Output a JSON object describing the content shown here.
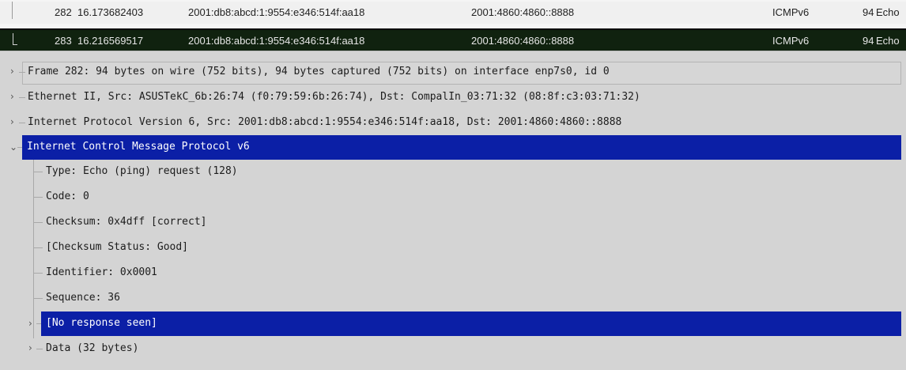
{
  "packets": [
    {
      "no": "282",
      "time": "16.173682403",
      "source": "2001:db8:abcd:1:9554:e346:514f:aa18",
      "destination": "2001:4860:4860::8888",
      "protocol": "ICMPv6",
      "length": "94",
      "info": "Echo"
    },
    {
      "no": "283",
      "time": "16.216569517",
      "source": "2001:db8:abcd:1:9554:e346:514f:aa18",
      "destination": "2001:4860:4860::8888",
      "protocol": "ICMPv6",
      "length": "94",
      "info": "Echo"
    }
  ],
  "tree": {
    "frame": "Frame 282: 94 bytes on wire (752 bits), 94 bytes captured (752 bits) on interface enp7s0, id 0",
    "ethernet": "Ethernet II, Src: ASUSTekC_6b:26:74 (f0:79:59:6b:26:74), Dst: CompalIn_03:71:32 (08:8f:c3:03:71:32)",
    "ipv6": "Internet Protocol Version 6, Src: 2001:db8:abcd:1:9554:e346:514f:aa18, Dst: 2001:4860:4860::8888",
    "icmpv6": "Internet Control Message Protocol v6",
    "fields": {
      "type": "Type: Echo (ping) request (128)",
      "code": "Code: 0",
      "checksum": "Checksum: 0x4dff [correct]",
      "checksum_status": "[Checksum Status: Good]",
      "identifier": "Identifier: 0x0001",
      "sequence": "Sequence: 36",
      "no_response": "[No response seen]",
      "data": "Data (32 bytes)"
    }
  },
  "icons": {
    "collapsed": "chevron-right-icon",
    "expanded": "chevron-down-icon"
  },
  "colors": {
    "selection": "#0b1fa6",
    "packet_selected_bg": "#10220f",
    "pane_bg": "#d4d4d4"
  }
}
